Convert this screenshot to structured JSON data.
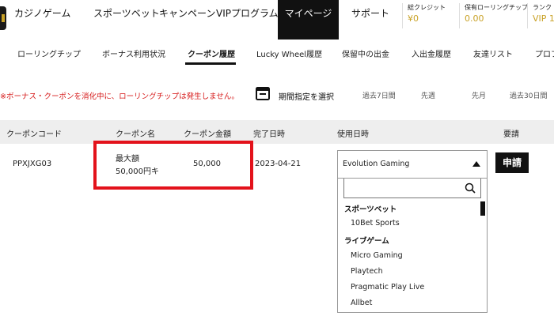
{
  "nav": {
    "items": [
      "カジノゲーム",
      "スポーツベット",
      "キャンペーン",
      "VIPプログラム",
      "マイページ",
      "サポート"
    ],
    "active": "マイページ"
  },
  "credits": [
    {
      "label": "総クレジット",
      "value": "¥0"
    },
    {
      "label": "保有ローリングチップ",
      "value": "0.00"
    },
    {
      "label": "ランク",
      "value": "VIP 1"
    }
  ],
  "subtabs": [
    "ローリングチップ",
    "ボーナス利用状況",
    "クーポン履歴",
    "Lucky Wheel履歴",
    "保留中の出金",
    "入出金履歴",
    "友達リスト",
    "プロフ"
  ],
  "active_subtab": "クーポン履歴",
  "notice": "※ボーナス・クーポンを消化中に、ローリングチップは発生しません。",
  "period": {
    "label": "期間指定を選択",
    "options": [
      "過去7日間",
      "先週",
      "先月",
      "過去30日間"
    ]
  },
  "table": {
    "headers": [
      "クーポンコード",
      "クーポン名",
      "クーポン金額",
      "完了日時",
      "使用日時",
      "要請"
    ],
    "row": {
      "code": "PPXJXG03",
      "name_line1": "最大額",
      "name_line2": "50,000円キ",
      "amount": "50,000",
      "completed": "2023-04-21",
      "apply_label": "申請"
    }
  },
  "dropdown": {
    "selected": "Evolution Gaming",
    "search_placeholder": "",
    "groups": [
      {
        "label": "スポーツベット",
        "options": [
          "10Bet Sports"
        ]
      },
      {
        "label": "ライブゲーム",
        "options": [
          "Micro Gaming",
          "Playtech",
          "Pragmatic Play Live",
          "Allbet"
        ]
      }
    ]
  },
  "colors": {
    "accent_gold": "#c9a227",
    "notice_red": "#d61a1a",
    "highlight_red": "#e3121b"
  }
}
